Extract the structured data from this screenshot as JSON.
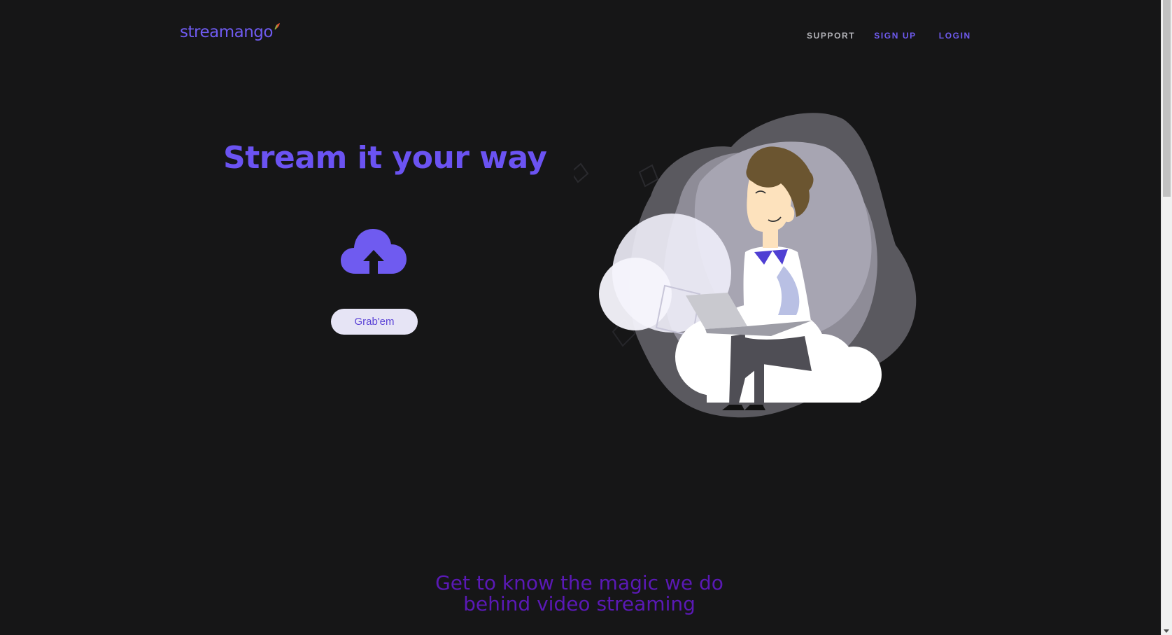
{
  "header": {
    "logo_text": "streamango",
    "nav": {
      "support": "SUPPORT",
      "signup": "SIGN UP",
      "login": "LOGIN"
    }
  },
  "hero": {
    "title": "Stream it your way",
    "upload_icon": "cloud-upload-icon",
    "button_label": "Grab'em",
    "illustration": "man-with-laptop-on-cloud"
  },
  "section": {
    "title_line1": "Get to know the magic we do",
    "title_line2": "behind video streaming"
  },
  "colors": {
    "background": "#161617",
    "accent": "#6b53f2",
    "section_title": "#5a19b5",
    "button_bg": "#e6e4f5"
  }
}
